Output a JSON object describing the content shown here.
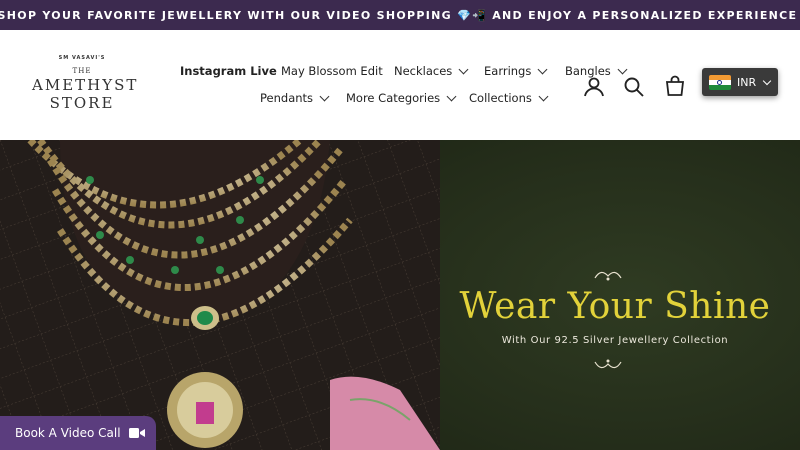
{
  "announcement": "👀SHOP YOUR FAVORITE JEWELLERY WITH OUR VIDEO SHOPPING 💎📲 AND ENJOY A PERSONALIZED EXPERIENCE ✨",
  "logo": {
    "line1": "SM VASAVI'S",
    "line2": "THE",
    "line3": "AMETHYST",
    "line4": "STORE"
  },
  "nav": {
    "row1": [
      {
        "label": "Instagram Live",
        "dropdown": false
      },
      {
        "label": "May Blossom Edit",
        "dropdown": false
      },
      {
        "label": "Necklaces",
        "dropdown": true
      },
      {
        "label": "Earrings",
        "dropdown": true
      },
      {
        "label": "Bangles",
        "dropdown": true
      }
    ],
    "row2": [
      {
        "label": "Pendants",
        "dropdown": true
      },
      {
        "label": "More Categories",
        "dropdown": true
      },
      {
        "label": "Collections",
        "dropdown": true
      }
    ]
  },
  "header_icons": [
    "account-icon",
    "search-icon",
    "cart-icon"
  ],
  "currency": {
    "code": "INR",
    "flag": "india-flag"
  },
  "hero": {
    "headline": "Wear Your Shine",
    "subline": "With Our 92.5 Silver Jewellery Collection"
  },
  "video_call": {
    "label": "Book A Video Call",
    "icon": "video-camera-icon"
  },
  "colors": {
    "announcement_bg": "#3c2a4f",
    "hero_bg": "#27321c",
    "headline": "#e2d23a",
    "video_btn": "#5b3d7e"
  }
}
